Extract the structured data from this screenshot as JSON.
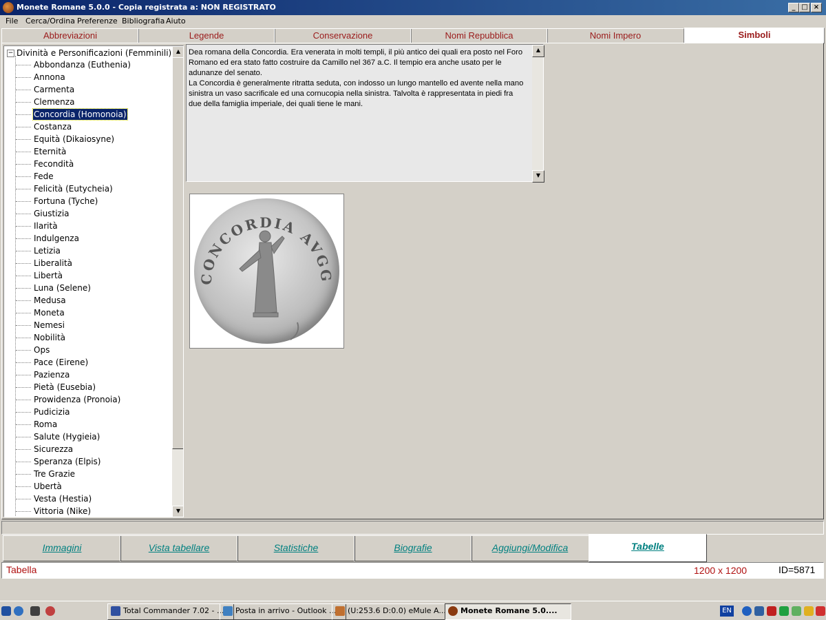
{
  "window": {
    "title": "Monete Romane 5.0.0 - Copia registrata a:  NON REGISTRATO",
    "minimize": "_",
    "maximize": "□",
    "close": "×"
  },
  "menu": [
    "File",
    "Cerca/Ordina",
    "Preferenze",
    "Bibliografia",
    "Aiuto"
  ],
  "top_tabs": [
    "Abbreviazioni",
    "Legende",
    "Conservazione",
    "Nomi Repubblica",
    "Nomi Impero",
    "Simboli"
  ],
  "tree": {
    "root_expander": "−",
    "root": "Divinità e Personificazioni (Femminili)",
    "items": [
      "Abbondanza (Euthenia)",
      "Annona",
      "Carmenta",
      "Clemenza",
      "Concordia (Homonoia)",
      "Costanza",
      "Equità (Dikaiosyne)",
      "Eternità",
      "Fecondità",
      "Fede",
      "Felicità (Eutycheia)",
      "Fortuna (Tyche)",
      "Giustizia",
      "Ilarità",
      "Indulgenza",
      "Letizia",
      "Liberalità",
      "Libertà",
      "Luna (Selene)",
      "Medusa",
      "Moneta",
      "Nemesi",
      "Nobilità",
      "Ops",
      "Pace (Eirene)",
      "Pazienza",
      "Pietà (Eusebia)",
      "Prowidenza (Pronoia)",
      "Pudicizia",
      "Roma",
      "Salute (Hygieia)",
      "Sicurezza",
      "Speranza (Elpis)",
      "Tre Grazie",
      "Ubertà",
      "Vesta (Hestia)",
      "Vittoria (Nike)"
    ],
    "selected": "Concordia (Homonoia)"
  },
  "description": "Dea romana della Concordia. Era venerata in molti templi, il più antico dei quali era posto nel Foro Romano ed era stato fatto costruire da Camillo nel 367 a.C. Il tempio era anche usato per le adunanze del senato.\nLa Concordia è generalmente ritratta seduta, con indosso un lungo mantello ed avente nella mano sinistra un vaso sacrificale ed una cornucopia nella sinistra. Talvolta è rappresentata in piedi fra due della famiglia imperiale, dei quali tiene le mani.",
  "coin_legend": "CONCORDIA AVGG",
  "bottom_tabs": [
    "Immagini",
    "Vista tabellare",
    "Statistiche",
    "Biografie",
    "Aggiungi/Modifica",
    "Tabelle"
  ],
  "status": {
    "left": "Tabella",
    "size": "1200 x 1200",
    "id": "ID=5871"
  },
  "taskbar": {
    "tasks": [
      "Total Commander 7.02 - ...",
      "Posta in arrivo - Outlook ...",
      "(U:253.6 D:0.0) eMule A...",
      "Monete Romane 5.0...."
    ],
    "lang": "EN"
  },
  "colors": {
    "title_bar": "#0a246a",
    "tab_text": "#9a1a1a",
    "bottom_tab_text": "#008080",
    "selection": "#0a246a"
  }
}
